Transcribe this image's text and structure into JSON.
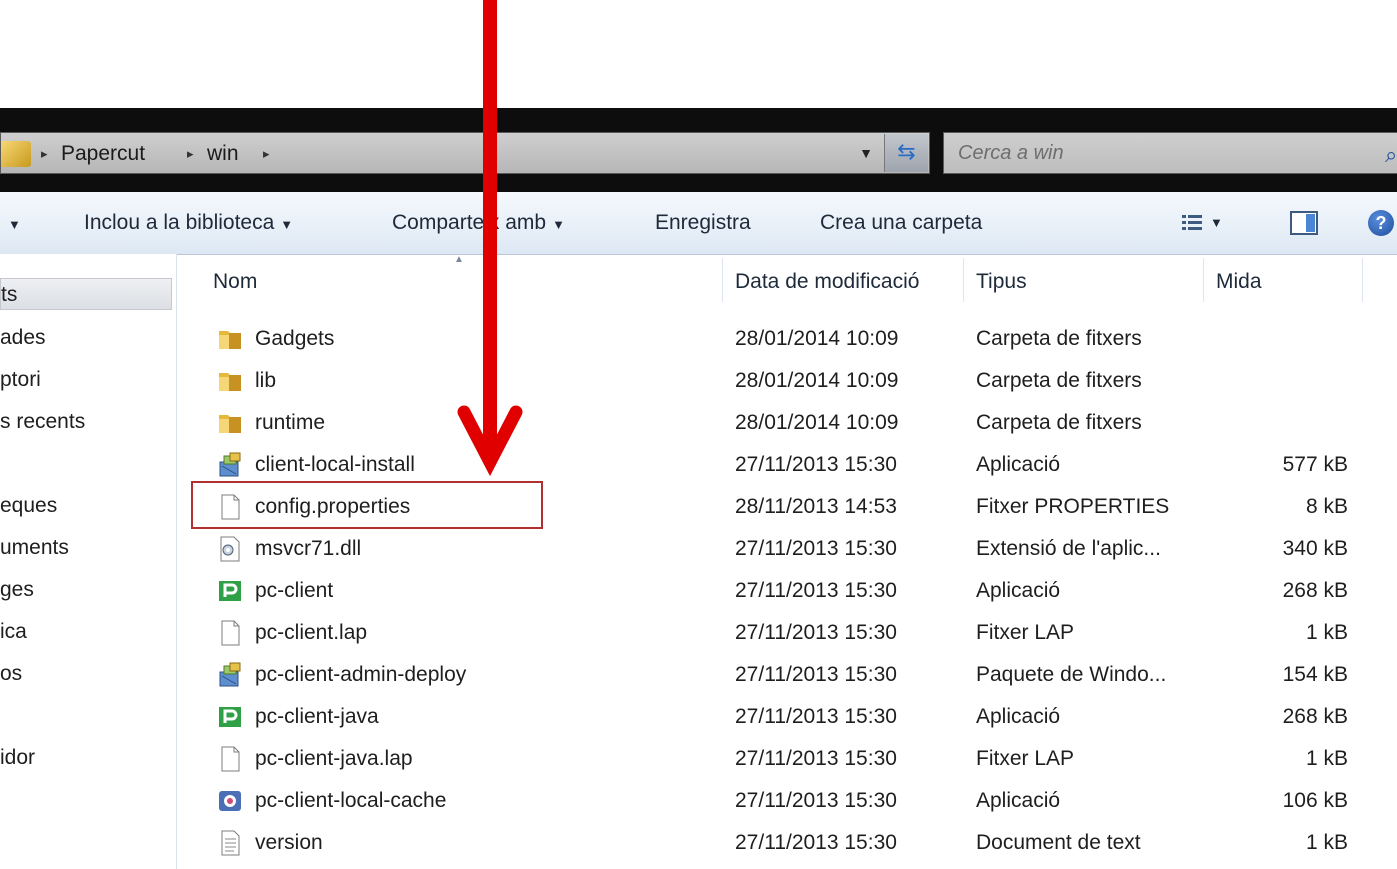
{
  "address": {
    "crumbs": [
      "Papercut",
      "win"
    ],
    "separator": "▸"
  },
  "search": {
    "placeholder": "Cerca a win"
  },
  "toolbar": {
    "include_library": "Inclou a la biblioteca",
    "share_with": "Comparteix amb",
    "burn": "Enregistra",
    "new_folder": "Crea una carpeta",
    "help": "?"
  },
  "nav": {
    "items": [
      "ts",
      "ades",
      "ptori",
      "s recents",
      "eques",
      "uments",
      "ges",
      "ica",
      "os",
      "idor"
    ]
  },
  "columns": {
    "name": "Nom",
    "date": "Data de modificació",
    "type": "Tipus",
    "size": "Mida"
  },
  "files": [
    {
      "name": "Gadgets",
      "date": "28/01/2014 10:09",
      "type": "Carpeta de fitxers",
      "size": "",
      "icon": "folder-icon"
    },
    {
      "name": "lib",
      "date": "28/01/2014 10:09",
      "type": "Carpeta de fitxers",
      "size": "",
      "icon": "folder-icon"
    },
    {
      "name": "runtime",
      "date": "28/01/2014 10:09",
      "type": "Carpeta de fitxers",
      "size": "",
      "icon": "folder-icon"
    },
    {
      "name": "client-local-install",
      "date": "27/11/2013 15:30",
      "type": "Aplicació",
      "size": "577 kB",
      "icon": "installer-icon"
    },
    {
      "name": "config.properties",
      "date": "28/11/2013 14:53",
      "type": "Fitxer PROPERTIES",
      "size": "8 kB",
      "icon": "file-icon"
    },
    {
      "name": "msvcr71.dll",
      "date": "27/11/2013 15:30",
      "type": "Extensió de l'aplic...",
      "size": "340 kB",
      "icon": "dll-icon"
    },
    {
      "name": "pc-client",
      "date": "27/11/2013 15:30",
      "type": "Aplicació",
      "size": "268 kB",
      "icon": "papercut-app-icon"
    },
    {
      "name": "pc-client.lap",
      "date": "27/11/2013 15:30",
      "type": "Fitxer LAP",
      "size": "1 kB",
      "icon": "file-icon"
    },
    {
      "name": "pc-client-admin-deploy",
      "date": "27/11/2013 15:30",
      "type": "Paquete de Windo...",
      "size": "154 kB",
      "icon": "installer-icon"
    },
    {
      "name": "pc-client-java",
      "date": "27/11/2013 15:30",
      "type": "Aplicació",
      "size": "268 kB",
      "icon": "papercut-app-icon"
    },
    {
      "name": "pc-client-java.lap",
      "date": "27/11/2013 15:30",
      "type": "Fitxer LAP",
      "size": "1 kB",
      "icon": "file-icon"
    },
    {
      "name": "pc-client-local-cache",
      "date": "27/11/2013 15:30",
      "type": "Aplicació",
      "size": "106 kB",
      "icon": "cache-app-icon"
    },
    {
      "name": "version",
      "date": "27/11/2013 15:30",
      "type": "Document de text",
      "size": "1 kB",
      "icon": "text-file-icon"
    }
  ],
  "colors": {
    "annotation_red": "#e00000",
    "highlight_border": "#b03030",
    "toolbar_top": "#f6f9fd",
    "toolbar_bottom": "#dde8f4"
  }
}
